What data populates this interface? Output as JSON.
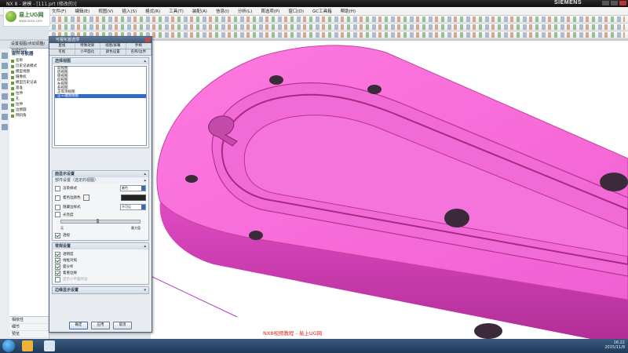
{
  "window": {
    "title": "NX 8 - 建模 - [111.prt (修改的)]",
    "brand": "SIEMENS"
  },
  "logo": {
    "name": "易上UG网",
    "url": "www.ooxx.com"
  },
  "menu": [
    "文件(F)",
    "编辑(E)",
    "视图(V)",
    "插入(S)",
    "格式(R)",
    "工具(T)",
    "装配(A)",
    "信息(I)",
    "分析(L)",
    "首选项(P)",
    "窗口(O)",
    "GC工具箱",
    "帮助(H)"
  ],
  "nav": {
    "header": "设置视图/点动调整/加载时间",
    "title": "部件导航器",
    "tree": [
      "名称",
      "历史记录模式",
      "模型视图",
      "摄像机",
      "模型历史记录",
      "基准",
      "拉伸",
      "孔",
      "拉伸",
      "边倒圆",
      "倒斜角"
    ],
    "bottom": [
      "相依性",
      "细节",
      "预览"
    ]
  },
  "dialog": {
    "title": "可视化首选项",
    "tabs_row1": [
      "直线",
      "特殊效果",
      "视图/屏幕",
      "手柄"
    ],
    "tabs_row2": [
      "可视",
      "小平面化",
      "颜色设置",
      "名称/边界"
    ],
    "section_views": "选择视图",
    "views": [
      "前视图",
      "后视图",
      "俯视图",
      "仰视图",
      "左视图",
      "右视图",
      "正等测视图",
      "正三轴测视图"
    ],
    "selected_view": "正三轴测视图",
    "section_display": "面显示设置",
    "section_component": "部件设置（选定的视图）",
    "render_style_label": "渲染样式",
    "render_style_value": "着色",
    "shaded_edges_label": "着色边颜色",
    "hidden_edges_label": "隐藏边样式",
    "hidden_edges_value": "不可见",
    "transparency_label": "光亮度",
    "min_label": "无",
    "max_label": "最大值",
    "perspective_label": "透视",
    "section_general": "常规设置",
    "general_options": [
      "透明度",
      "线框对照",
      "面分析",
      "着重边缘",
      "显示小平面的边"
    ],
    "section_edge": "边缘显示设置",
    "ok": "确定",
    "apply": "应用",
    "cancel": "取消"
  },
  "caption": "NX8视频教程 - 易上UG网",
  "tray": {
    "time": "16:22",
    "date": "2015/11/8"
  }
}
